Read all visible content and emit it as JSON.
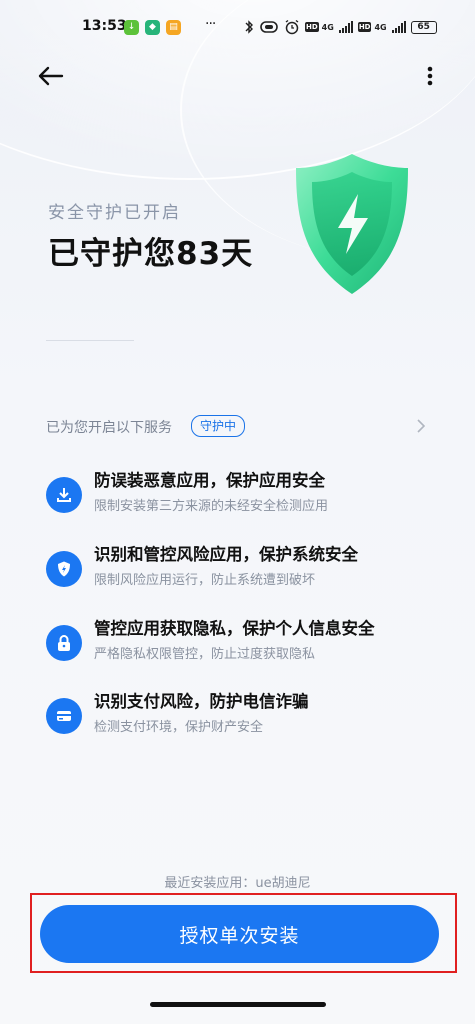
{
  "status_bar": {
    "time": "13:53",
    "network_label_1": "4G",
    "network_label_2": "4G",
    "hd_label": "HD",
    "battery": "65",
    "overflow_dots": "···"
  },
  "hero": {
    "subtitle": "安全守护已开启",
    "title": "已守护您83天"
  },
  "services": {
    "label": "已为您开启以下服务",
    "badge": "守护中",
    "items": [
      {
        "title": "防误装恶意应用，保护应用安全",
        "desc": "限制安装第三方来源的未经安全检测应用",
        "icon": "download-icon"
      },
      {
        "title": "识别和管控风险应用，保护系统安全",
        "desc": "限制风险应用运行，防止系统遭到破坏",
        "icon": "shield-icon"
      },
      {
        "title": "管控应用获取隐私，保护个人信息安全",
        "desc": "严格隐私权限管控，防止过度获取隐私",
        "icon": "lock-icon"
      },
      {
        "title": "识别支付风险，防护电信诈骗",
        "desc": "检测支付环境，保护财产安全",
        "icon": "card-icon"
      }
    ]
  },
  "footer": {
    "recent_install": "最近安装应用：ue胡迪尼",
    "install_button": "授权单次安装"
  },
  "colors": {
    "accent": "#1b77f2",
    "highlight_border": "#e02020",
    "shield_green": "#3ddc97"
  }
}
